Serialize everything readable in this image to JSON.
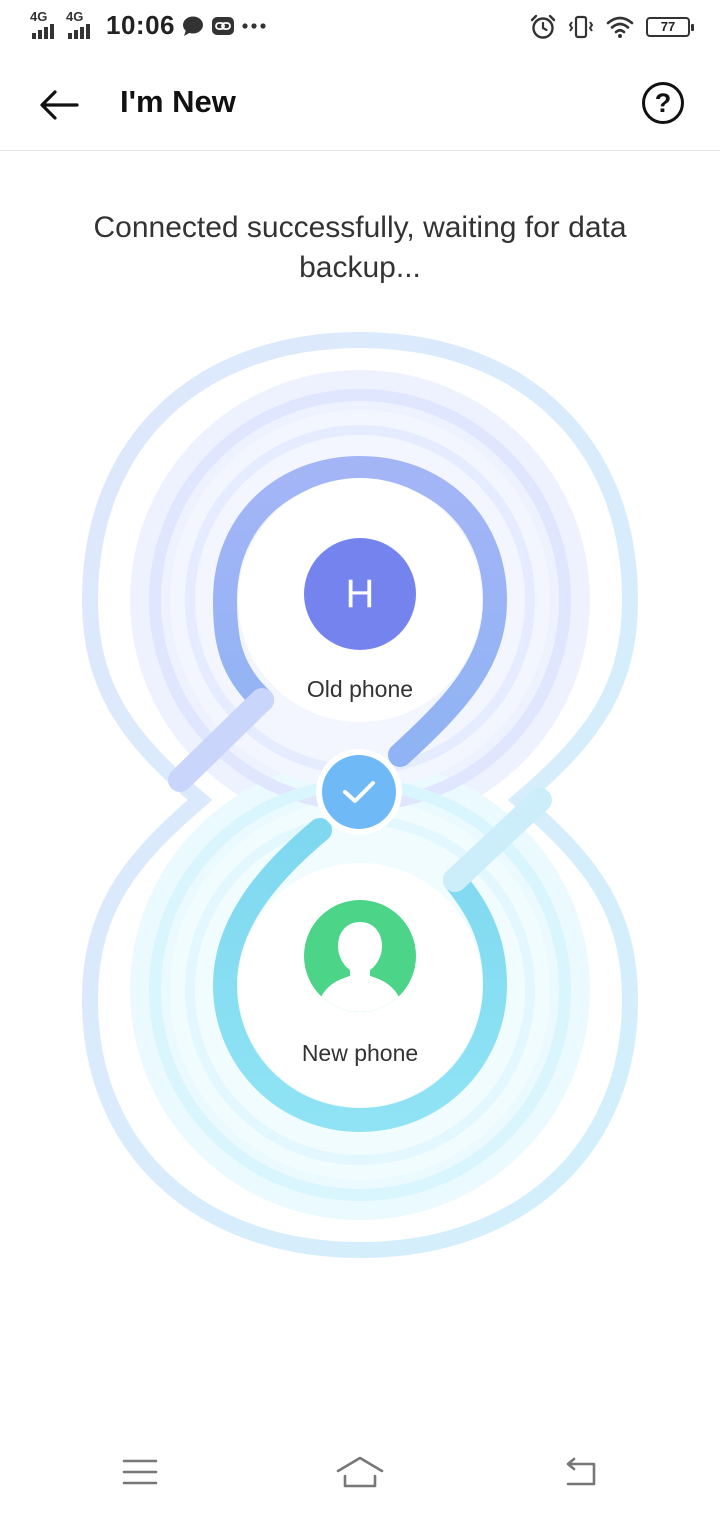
{
  "status_bar": {
    "signal_1": "4G",
    "signal_2": "4G",
    "time": "10:06",
    "battery": "77",
    "icons": [
      "chat-bubble-icon",
      "link-icon",
      "more-dots-icon",
      "alarm-icon",
      "vibrate-icon",
      "wifi-icon",
      "battery-icon"
    ]
  },
  "app_bar": {
    "title": "I'm New",
    "help": "?"
  },
  "main": {
    "message": "Connected successfully, waiting for data backup...",
    "old_phone": {
      "initial": "H",
      "label": "Old phone",
      "color": "#7583ee"
    },
    "new_phone": {
      "label": "New phone",
      "color": "#4cd488"
    },
    "connection_color": "#6fb9f7"
  },
  "nav_bar": {
    "icons": [
      "menu-icon",
      "home-icon",
      "back-nav-icon"
    ]
  }
}
